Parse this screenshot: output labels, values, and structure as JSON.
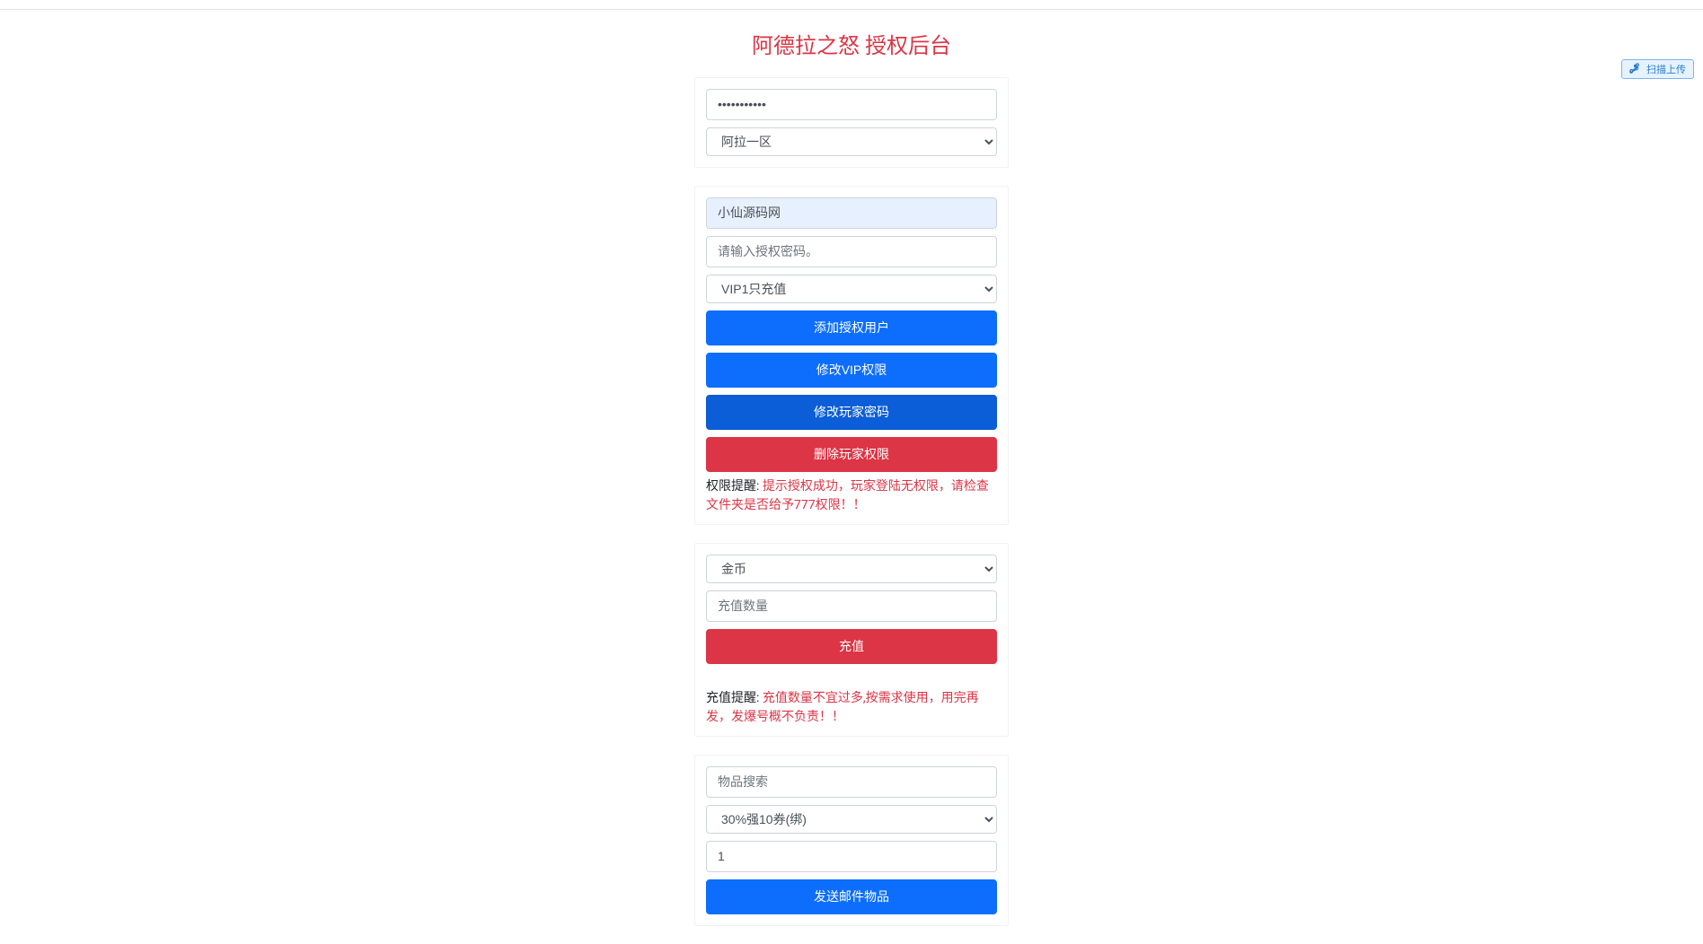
{
  "page": {
    "title": "阿德拉之怒 授权后台"
  },
  "login": {
    "password_value": "•••••••••••",
    "server_selected": "阿拉一区"
  },
  "auth": {
    "username_value": "小仙源码网",
    "auth_code_placeholder": "请输入授权密码。",
    "vip_selected": "VIP1只充值",
    "btn_add_user": "添加授权用户",
    "btn_modify_vip": "修改VIP权限",
    "btn_modify_password": "修改玩家密码",
    "btn_delete_permission": "删除玩家权限",
    "warning_label": "权限提醒: ",
    "warning_content": "提示授权成功，玩家登陆无权限，请检查文件夹是否给予777权限！！"
  },
  "recharge": {
    "type_selected": "金币",
    "amount_placeholder": "充值数量",
    "btn_recharge": "充值",
    "warning_label": "充值提醒: ",
    "warning_content": "充值数量不宜过多,按需求使用，用完再发，发爆号概不负责！！"
  },
  "mail": {
    "search_placeholder": "物品搜索",
    "item_selected": "30%强10券(绑)",
    "quantity_value": "1",
    "btn_send": "发送邮件物品"
  },
  "widget": {
    "upload_label": "扫描上传"
  }
}
